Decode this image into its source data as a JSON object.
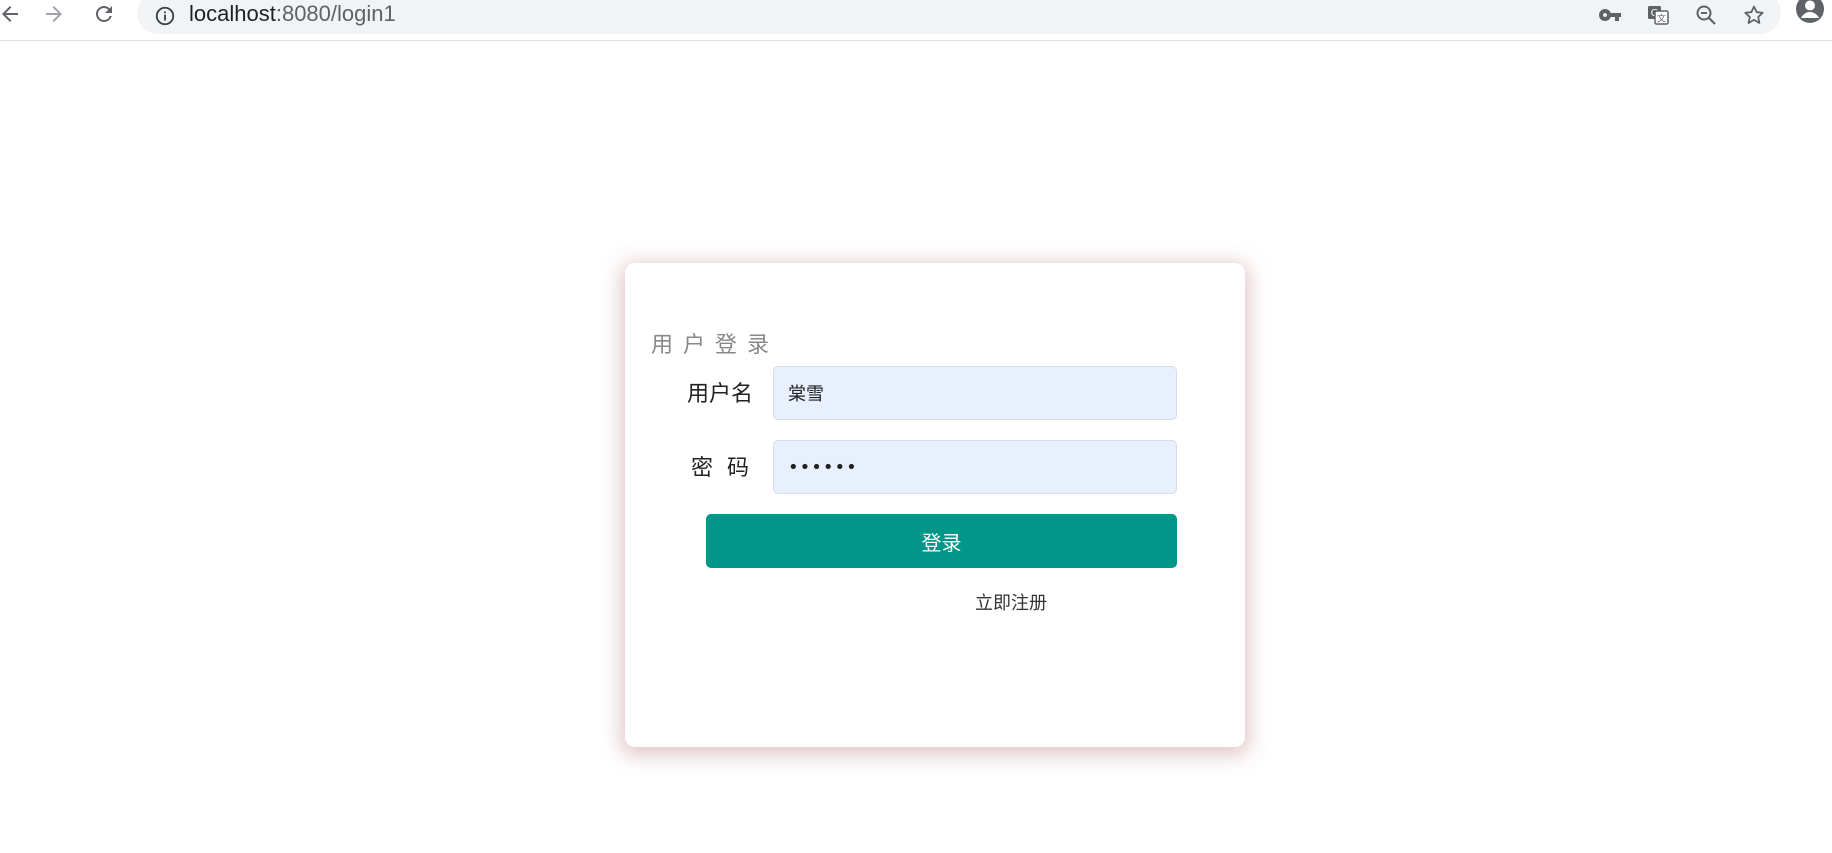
{
  "browser": {
    "url_host": "localhost",
    "url_rest": ":8080/login1",
    "icons": {
      "back": "arrow-left-icon",
      "forward": "arrow-right-icon",
      "reload": "reload-icon",
      "site_info": "info-icon",
      "password_key": "key-icon",
      "translate": "translate-icon",
      "zoom": "zoom-out-icon",
      "bookmark": "star-icon",
      "profile": "profile-icon"
    }
  },
  "login": {
    "title": "用户登录",
    "username_label": "用户名",
    "password_label": "密码",
    "username_value": "棠雪",
    "password_value": "••••••",
    "submit_label": "登录",
    "register_link": "立即注册"
  },
  "colors": {
    "primary": "#009688",
    "input_bg": "#e8f0fe",
    "title_gray": "#888888"
  }
}
